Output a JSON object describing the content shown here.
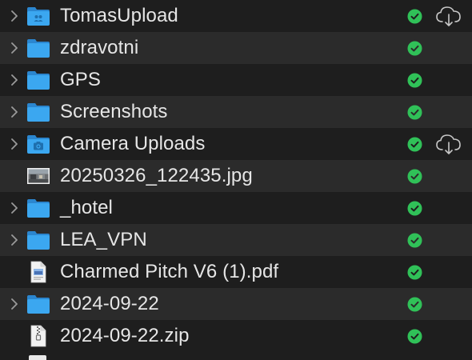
{
  "window": {
    "title": ""
  },
  "colors": {
    "folder_blue": "#3ba7f0",
    "folder_back": "#2b86cf",
    "status_green": "#30c158",
    "text": "#e6e6e6",
    "row_alt": "#2b2b2b",
    "row_base": "#1e1e1e"
  },
  "rows": [
    {
      "name": "TomasUpload",
      "kind": "folder-shared",
      "expandable": true,
      "status": "synced",
      "cloud": true
    },
    {
      "name": "zdravotni",
      "kind": "folder",
      "expandable": true,
      "status": "synced",
      "cloud": false
    },
    {
      "name": "GPS",
      "kind": "folder",
      "expandable": true,
      "status": "synced",
      "cloud": false
    },
    {
      "name": "Screenshots",
      "kind": "folder",
      "expandable": true,
      "status": "synced",
      "cloud": false
    },
    {
      "name": "Camera Uploads",
      "kind": "folder-camera",
      "expandable": true,
      "status": "synced",
      "cloud": true
    },
    {
      "name": "20250326_122435.jpg",
      "kind": "image",
      "expandable": false,
      "status": "synced",
      "cloud": false
    },
    {
      "name": "_hotel",
      "kind": "folder",
      "expandable": true,
      "status": "synced",
      "cloud": false
    },
    {
      "name": "LEA_VPN",
      "kind": "folder",
      "expandable": true,
      "status": "synced",
      "cloud": false
    },
    {
      "name": "Charmed Pitch V6 (1).pdf",
      "kind": "pdf",
      "expandable": false,
      "status": "synced",
      "cloud": false
    },
    {
      "name": "2024-09-22",
      "kind": "folder",
      "expandable": true,
      "status": "synced",
      "cloud": false
    },
    {
      "name": "2024-09-22.zip",
      "kind": "zip",
      "expandable": false,
      "status": "synced",
      "cloud": false
    }
  ]
}
